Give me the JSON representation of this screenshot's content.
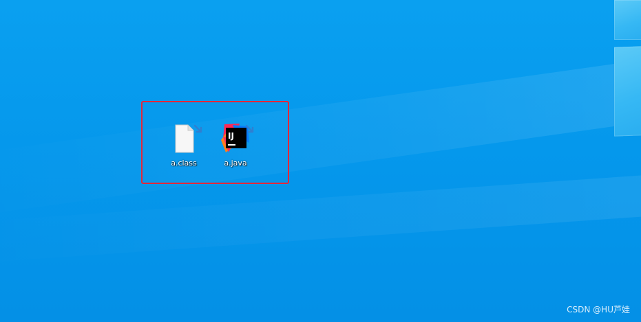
{
  "desktop": {
    "icons": [
      {
        "label": "a.class",
        "icon": "blank-file-icon"
      },
      {
        "label": "a.java",
        "icon": "intellij-idea-icon",
        "icon_text": "IJ"
      }
    ],
    "selection_color": "#e3273a"
  },
  "watermark": {
    "text": "CSDN @HU芦娃"
  },
  "colors": {
    "desktop_background": "#0598ec",
    "accent_window": "#5ccaf7",
    "intellij_pink": "#fe2857",
    "intellij_orange": "#fc801d",
    "intellij_blue": "#087cfa"
  }
}
